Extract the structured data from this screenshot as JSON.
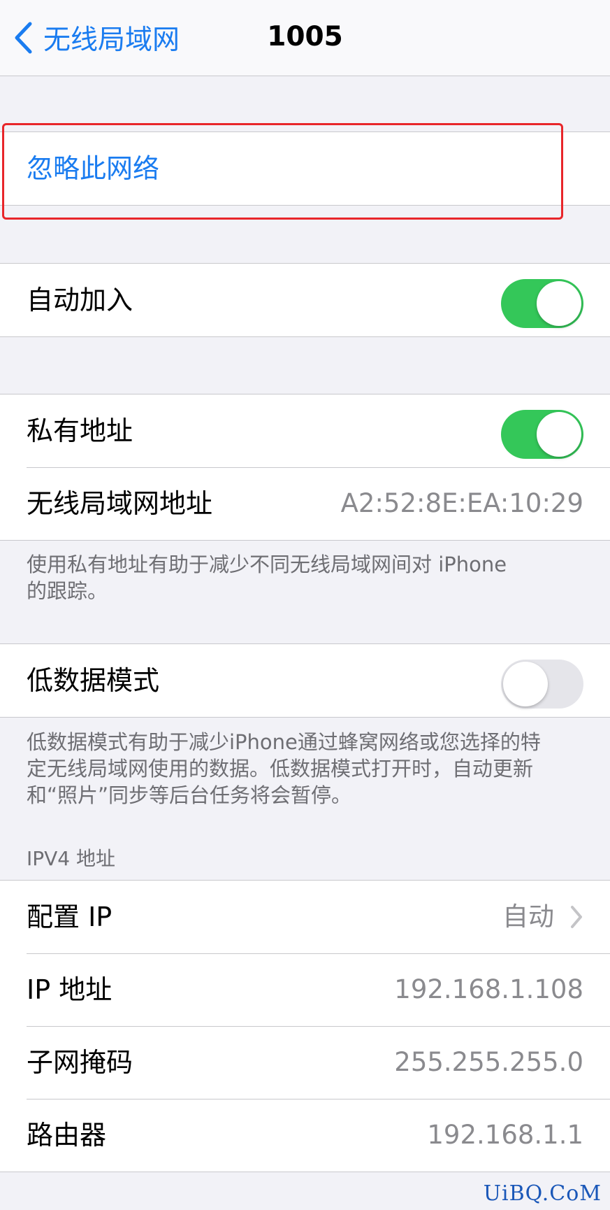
{
  "nav": {
    "back_label": "无线局域网",
    "title": "1005"
  },
  "forget": {
    "label": "忽略此网络"
  },
  "auto_join": {
    "label": "自动加入",
    "on": true
  },
  "private": {
    "private_label": "私有地址",
    "private_on": true,
    "wifi_address_label": "无线局域网地址",
    "wifi_address_value": "A2:52:8E:EA:10:29",
    "footnote_line1": "使用私有地址有助于减少不同无线局域网间对 iPhone",
    "footnote_line2": "的跟踪。"
  },
  "low_data": {
    "label": "低数据模式",
    "on": false,
    "footnote_line1": "低数据模式有助于减少iPhone通过蜂窝网络或您选择的特",
    "footnote_line2": "定无线局域网使用的数据。低数据模式打开时，自动更新",
    "footnote_line3": "和“照片”同步等后台任务将会暂停。"
  },
  "ipv4": {
    "header": "IPV4 地址",
    "rows": [
      {
        "label": "配置 IP",
        "value": "自动"
      },
      {
        "label": "IP 地址",
        "value": "192.168.1.108"
      },
      {
        "label": "子网掩码",
        "value": "255.255.255.0"
      },
      {
        "label": "路由器",
        "value": "192.168.1.1"
      }
    ]
  },
  "colors": {
    "accent": "#1a7cf0",
    "toggle_on": "#34c759",
    "highlight": "#e8262a"
  },
  "watermark": "UiBQ.CoM"
}
